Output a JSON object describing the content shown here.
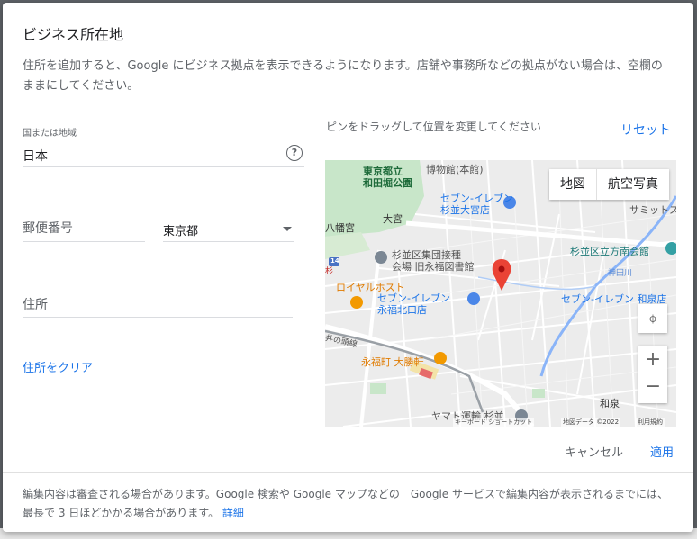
{
  "dialog": {
    "title": "ビジネス所在地",
    "description": "住所を追加すると、Google にビジネス拠点を表示できるようになります。店舗や事務所などの拠点がない場合は、空欄のままにしてください。"
  },
  "form": {
    "country_label": "国または地域",
    "country_value": "日本",
    "postal_placeholder": "郵便番号",
    "prefecture_value": "東京都",
    "address_placeholder": "住所",
    "clear_link": "住所をクリア"
  },
  "map": {
    "pin_help": "ピンをドラッグして位置を変更してください",
    "reset_label": "リセット",
    "type_map": "地図",
    "type_satellite": "航空写真",
    "labels": {
      "park": "東京都立\n和田堀公園",
      "museum": "博物館(本館)",
      "omiya": "大宮",
      "hachiman": "八幡宮",
      "seven1": "セブン-イレブン\n杉並大宮店",
      "summit": "サミットス",
      "library": "杉並区集団接種\n会場 旧永福図書館",
      "tachibana": "杉並区立方南会館",
      "kanda": "神田川",
      "royal": "ロイヤルホスト",
      "seven2": "セブン-イレブン\n永福北口店",
      "seven3": "セブン-イレブン 和泉店",
      "tsuki": "井の頭線",
      "taishoken": "永福町 大勝軒",
      "izumi": "和泉",
      "yamato": "ヤマト運輸 杉並",
      "route14": "14",
      "sugi": "杉"
    },
    "attribution_keys": "キーボード ショートカット",
    "attribution_data": "地図データ ©2022",
    "attribution_terms": "利用規約"
  },
  "actions": {
    "cancel": "キャンセル",
    "apply": "適用"
  },
  "footer": {
    "text": "編集内容は審査される場合があります。Google 検索や Google マップなどの　Google サービスで編集内容が表示されるまでには、最長で 3 日ほどかかる場合があります。",
    "link": "詳細"
  },
  "colors": {
    "accent": "#1a73e8",
    "pin": "#ea4335",
    "park": "#c8e6c9",
    "water": "#8ab4f8"
  }
}
